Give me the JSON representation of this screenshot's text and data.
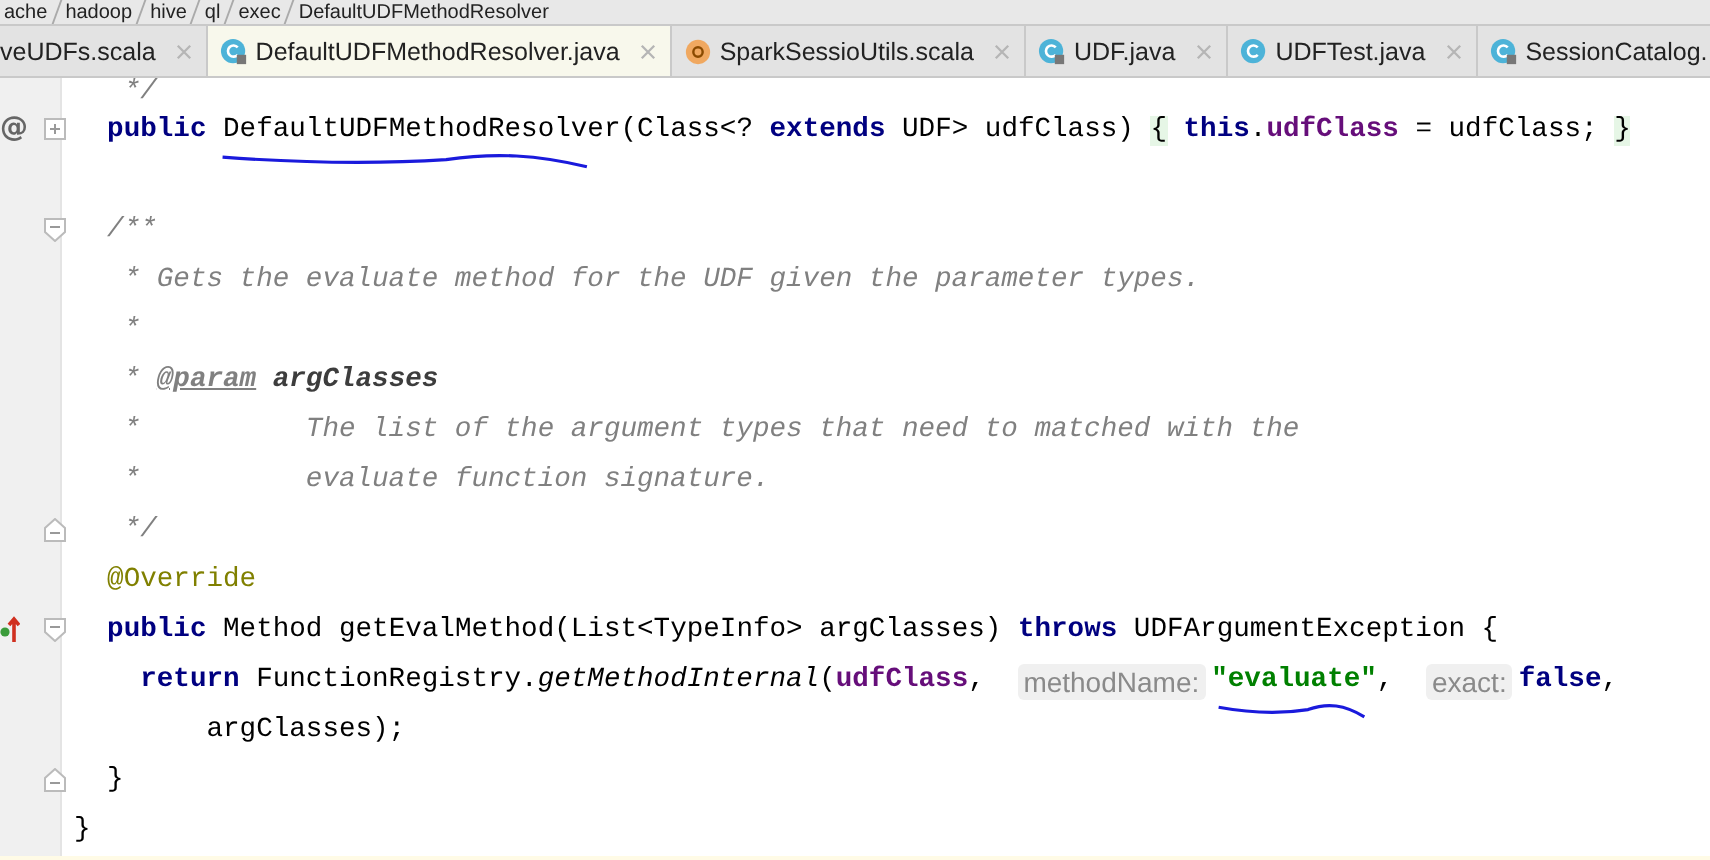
{
  "breadcrumbs": [
    "ache",
    "hadoop",
    "hive",
    "ql",
    "exec",
    "DefaultUDFMethodResolver"
  ],
  "tabs": [
    {
      "label": "veUDFs.scala",
      "kind": "none",
      "selected": false,
      "closable": true
    },
    {
      "label": "DefaultUDFMethodResolver.java",
      "kind": "class",
      "selected": true,
      "closable": true
    },
    {
      "label": "SparkSessioUtils.scala",
      "kind": "scala",
      "selected": false,
      "closable": true
    },
    {
      "label": "UDF.java",
      "kind": "class",
      "selected": false,
      "closable": true
    },
    {
      "label": "UDFTest.java",
      "kind": "test",
      "selected": false,
      "closable": true
    },
    {
      "label": "SessionCatalog.",
      "kind": "class",
      "selected": false,
      "closable": false
    }
  ],
  "lines": [
    {
      "short": true,
      "tokens": [
        {
          "kind": "comment",
          "t": "   */"
        }
      ]
    },
    {
      "gutter_text": "@",
      "fold": {
        "kind": "expand"
      },
      "tokens": [
        {
          "kind": "keyword",
          "t": "  public"
        },
        {
          "kind": "plain",
          "t": " DefaultUDFMethodResolver",
          "underlined": true
        },
        {
          "kind": "plain",
          "t": "(Class<? "
        },
        {
          "kind": "keyword",
          "t": "extends"
        },
        {
          "kind": "plain",
          "t": " UDF> udfClass) "
        },
        {
          "kind": "brace",
          "t": "{"
        },
        {
          "kind": "keyword",
          "t": " this"
        },
        {
          "kind": "plain",
          "t": "."
        },
        {
          "kind": "field",
          "t": "udfClass"
        },
        {
          "kind": "plain",
          "t": " = udfClass; "
        },
        {
          "kind": "brace",
          "t": "}"
        }
      ]
    },
    {
      "short": false
    },
    {
      "fold": {
        "kind": "start"
      },
      "tokens": [
        {
          "kind": "comment",
          "t": "  /**"
        }
      ]
    },
    {
      "tokens": [
        {
          "kind": "comment",
          "t": "   * Gets the evaluate method for the UDF given the parameter types."
        }
      ]
    },
    {
      "tokens": [
        {
          "kind": "comment",
          "t": "   *"
        }
      ]
    },
    {
      "tokens": [
        {
          "kind": "comment",
          "t": "   * "
        },
        {
          "kind": "doctag",
          "t": "@param"
        },
        {
          "kind": "docparam",
          "t": " argClasses"
        }
      ]
    },
    {
      "tokens": [
        {
          "kind": "comment",
          "t": "   *          The list of the argument types that need to matched with the"
        }
      ]
    },
    {
      "tokens": [
        {
          "kind": "comment",
          "t": "   *          evaluate function signature."
        }
      ]
    },
    {
      "fold": {
        "kind": "end"
      },
      "tokens": [
        {
          "kind": "comment",
          "t": "   */"
        }
      ]
    },
    {
      "tokens": [
        {
          "kind": "annotation",
          "t": "  @Override"
        }
      ]
    },
    {
      "gutter_icon": {
        "kind": "override"
      },
      "fold": {
        "kind": "start"
      },
      "tokens": [
        {
          "kind": "keyword",
          "t": "  public"
        },
        {
          "kind": "plain",
          "t": " Method getEvalMethod(List<TypeInfo> argClasses) "
        },
        {
          "kind": "keyword",
          "t": "throws"
        },
        {
          "kind": "plain",
          "t": " UDFArgumentException {"
        }
      ]
    },
    {
      "tokens": [
        {
          "kind": "keyword",
          "t": "    return"
        },
        {
          "kind": "plain",
          "t": " FunctionRegistry."
        },
        {
          "kind": "static",
          "t": "getMethodInternal"
        },
        {
          "kind": "plain",
          "t": "("
        },
        {
          "kind": "field",
          "t": "udfClass"
        },
        {
          "kind": "plain",
          "t": ", "
        },
        {
          "kind": "hint",
          "t": "methodName:"
        },
        {
          "kind": "string",
          "t": "\"evaluate\"",
          "underlined": true
        },
        {
          "kind": "plain",
          "t": ", "
        },
        {
          "kind": "hint",
          "t": "exact:"
        },
        {
          "kind": "keyword",
          "t": "false"
        },
        {
          "kind": "plain",
          "t": ","
        }
      ]
    },
    {
      "tokens": [
        {
          "kind": "plain",
          "t": "        argClasses);"
        }
      ]
    },
    {
      "fold": {
        "kind": "end"
      },
      "tokens": [
        {
          "kind": "plain",
          "t": "  }"
        }
      ]
    },
    {
      "tokens": [
        {
          "kind": "plain",
          "t": "}"
        }
      ]
    }
  ]
}
